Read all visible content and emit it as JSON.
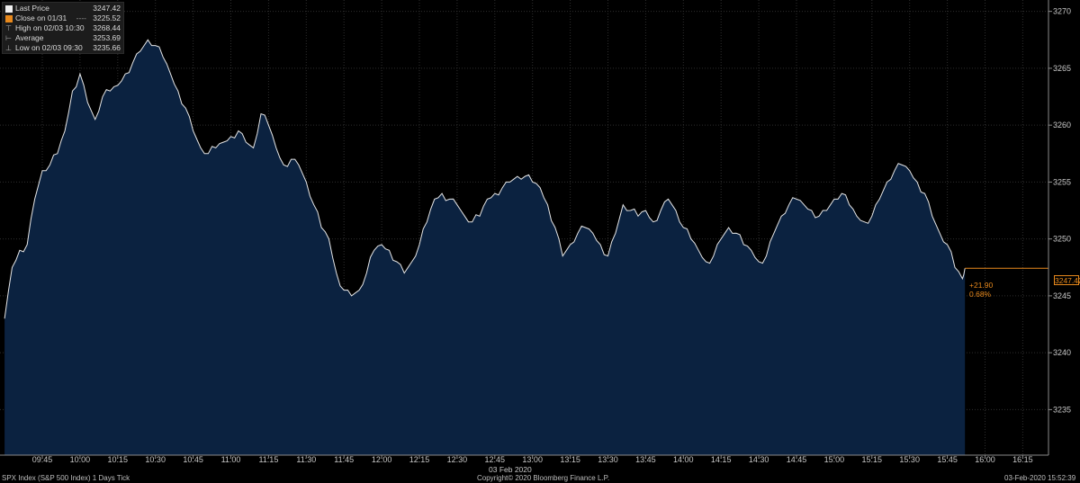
{
  "legend": {
    "last_price_label": "Last Price",
    "last_price_value": "3247.42",
    "close_label": "Close on 01/31",
    "close_value": "3225.52",
    "high_label": "High on 02/03 10:30",
    "high_value": "3268.44",
    "average_label": "Average",
    "average_value": "3253.69",
    "low_label": "Low on 02/03 09:30",
    "low_value": "3235.66"
  },
  "last_tag": "3247.42",
  "change_abs": "+21.90",
  "change_pct": "0.68%",
  "x_date_label": "03 Feb 2020",
  "footer": {
    "left": "SPX Index (S&P 500 Index) 1 Days  Tick",
    "center": "Copyright© 2020 Bloomberg Finance L.P.",
    "right": "03-Feb-2020 15:52:39"
  },
  "colors": {
    "area_fill": "#0b2240",
    "line": "#e6e6e6",
    "accent": "#e8891c",
    "grid": "#2e2e2e"
  },
  "chart_data": {
    "type": "area",
    "y_axis_side": "right",
    "ylim": [
      3231,
      3271
    ],
    "y_ticks": [
      3235,
      3240,
      3245,
      3250,
      3255,
      3260,
      3265,
      3270
    ],
    "x_ticks": [
      "09:45",
      "10:00",
      "10:15",
      "10:30",
      "10:45",
      "11:00",
      "11:15",
      "11:30",
      "11:45",
      "12:00",
      "12:15",
      "12:30",
      "12:45",
      "13:00",
      "13:15",
      "13:30",
      "13:45",
      "14:00",
      "14:15",
      "14:30",
      "14:45",
      "15:00",
      "15:15",
      "15:30",
      "15:45",
      "16:00",
      "16:15"
    ],
    "grid": true,
    "series": [
      {
        "x": [
          "09:30",
          "09:33",
          "09:36",
          "09:39",
          "09:42",
          "09:45",
          "09:48",
          "09:51",
          "09:54",
          "09:57",
          "10:00",
          "10:03",
          "10:06",
          "10:09",
          "10:12",
          "10:15",
          "10:18",
          "10:21",
          "10:24",
          "10:27",
          "10:30",
          "10:33",
          "10:36",
          "10:39",
          "10:42",
          "10:45",
          "10:48",
          "10:51",
          "10:54",
          "10:57",
          "11:00",
          "11:03",
          "11:06",
          "11:09",
          "11:12",
          "11:15",
          "11:18",
          "11:21",
          "11:24",
          "11:27",
          "11:30",
          "11:33",
          "11:36",
          "11:39",
          "11:42",
          "11:45",
          "11:48",
          "11:51",
          "11:54",
          "11:57",
          "12:00",
          "12:03",
          "12:06",
          "12:09",
          "12:12",
          "12:15",
          "12:18",
          "12:21",
          "12:24",
          "12:27",
          "12:30",
          "12:33",
          "12:36",
          "12:39",
          "12:42",
          "12:45",
          "12:48",
          "12:51",
          "12:54",
          "12:57",
          "13:00",
          "13:03",
          "13:06",
          "13:09",
          "13:12",
          "13:15",
          "13:18",
          "13:21",
          "13:24",
          "13:27",
          "13:30",
          "13:33",
          "13:36",
          "13:39",
          "13:42",
          "13:45",
          "13:48",
          "13:51",
          "13:54",
          "13:57",
          "14:00",
          "14:03",
          "14:06",
          "14:09",
          "14:12",
          "14:15",
          "14:18",
          "14:21",
          "14:24",
          "14:27",
          "14:30",
          "14:33",
          "14:36",
          "14:39",
          "14:42",
          "14:45",
          "14:48",
          "14:51",
          "14:54",
          "14:57",
          "15:00",
          "15:03",
          "15:06",
          "15:09",
          "15:12",
          "15:15",
          "15:18",
          "15:21",
          "15:24",
          "15:27",
          "15:30",
          "15:33",
          "15:36",
          "15:39",
          "15:42",
          "15:45",
          "15:48",
          "15:51",
          "15:52"
        ],
        "values": [
          3243.0,
          3247.5,
          3249.0,
          3249.5,
          3253.5,
          3256.0,
          3256.5,
          3257.5,
          3259.5,
          3263.0,
          3264.5,
          3262.0,
          3260.5,
          3262.5,
          3263.0,
          3263.5,
          3264.5,
          3265.5,
          3266.5,
          3267.5,
          3267.0,
          3266.0,
          3264.5,
          3263.0,
          3261.5,
          3259.5,
          3258.0,
          3257.5,
          3258.0,
          3258.5,
          3259.0,
          3259.5,
          3258.5,
          3258.0,
          3261.0,
          3260.0,
          3258.0,
          3256.5,
          3257.0,
          3256.5,
          3255.0,
          3253.0,
          3251.0,
          3250.0,
          3247.0,
          3245.5,
          3245.0,
          3245.5,
          3247.0,
          3249.0,
          3249.5,
          3249.0,
          3248.0,
          3247.0,
          3248.0,
          3249.5,
          3251.5,
          3253.5,
          3254.0,
          3253.5,
          3253.0,
          3252.0,
          3251.5,
          3252.0,
          3253.5,
          3254.0,
          3254.5,
          3255.0,
          3255.5,
          3255.5,
          3255.0,
          3254.5,
          3253.0,
          3251.0,
          3248.5,
          3249.5,
          3250.5,
          3251.0,
          3250.5,
          3249.5,
          3248.5,
          3250.5,
          3253.0,
          3252.5,
          3252.0,
          3252.5,
          3251.5,
          3252.5,
          3253.5,
          3252.5,
          3251.0,
          3250.0,
          3249.0,
          3248.0,
          3248.5,
          3250.0,
          3251.0,
          3250.5,
          3249.5,
          3249.0,
          3248.0,
          3248.5,
          3250.5,
          3252.0,
          3253.0,
          3253.5,
          3253.0,
          3252.5,
          3252.0,
          3252.5,
          3253.5,
          3254.0,
          3253.0,
          3252.0,
          3251.5,
          3252.0,
          3253.5,
          3255.0,
          3256.0,
          3256.5,
          3256.0,
          3255.0,
          3254.0,
          3252.0,
          3250.5,
          3249.5,
          3247.5,
          3246.5,
          3247.42
        ]
      }
    ],
    "annotations": [
      "+21.90",
      "0.68%"
    ]
  }
}
